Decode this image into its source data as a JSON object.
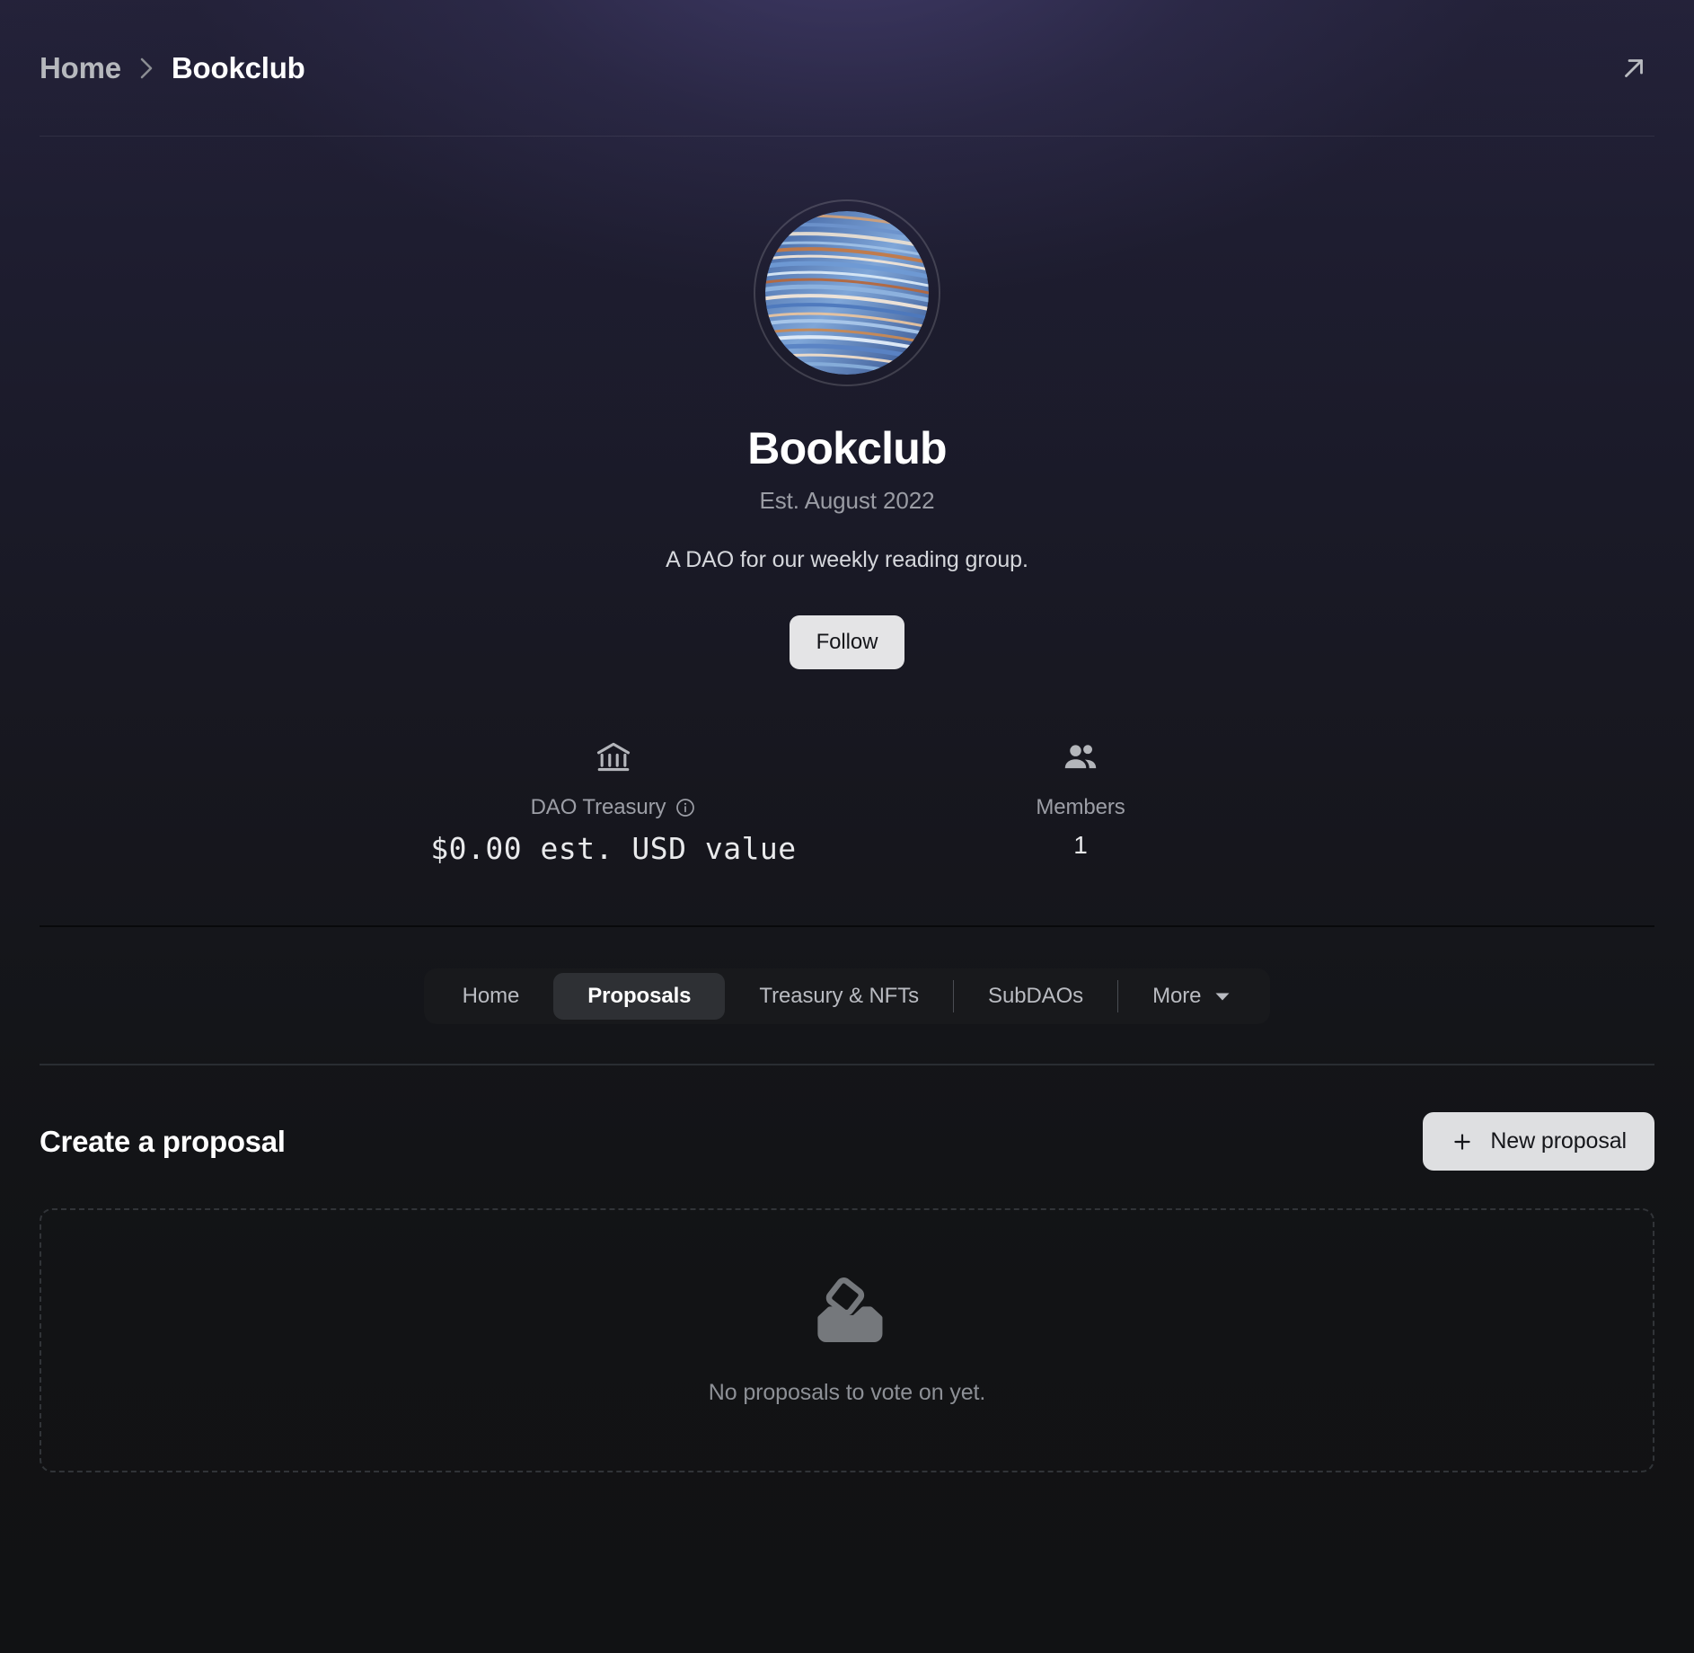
{
  "header": {
    "breadcrumb": {
      "home": "Home",
      "separator_icon": "chevron-right-icon",
      "current": "Bookclub"
    },
    "external_link_icon": "arrow-up-right-icon"
  },
  "hero": {
    "avatar_icon": "dao-avatar-image",
    "name": "Bookclub",
    "established": "Est. August 2022",
    "description": "A DAO for our weekly reading group.",
    "follow_label": "Follow"
  },
  "stats": [
    {
      "icon": "bank-icon",
      "label": "DAO Treasury",
      "info_icon": "info-icon",
      "value": "$0.00 est. USD value",
      "mono": true
    },
    {
      "icon": "members-icon",
      "label": "Members",
      "value": "1",
      "mono": false
    }
  ],
  "tabs": [
    {
      "label": "Home",
      "active": false,
      "divider_after": false
    },
    {
      "label": "Proposals",
      "active": true,
      "divider_after": false
    },
    {
      "label": "Treasury & NFTs",
      "active": false,
      "divider_after": true
    },
    {
      "label": "SubDAOs",
      "active": false,
      "divider_after": true
    },
    {
      "label": "More",
      "active": false,
      "divider_after": false,
      "caret_icon": "chevron-down-icon"
    }
  ],
  "proposals": {
    "section_title": "Create a proposal",
    "new_proposal_label": "New proposal",
    "new_proposal_icon": "plus-icon",
    "empty_icon": "ballot-box-icon",
    "empty_text": "No proposals to vote on yet."
  },
  "colors": {
    "page_background": "#111214",
    "hero_glow": "#24223a",
    "accent_button": "#e4e4e6",
    "active_tab": "#2e3034",
    "muted_text": "#9a9ca4",
    "primary_text": "#ffffff"
  }
}
